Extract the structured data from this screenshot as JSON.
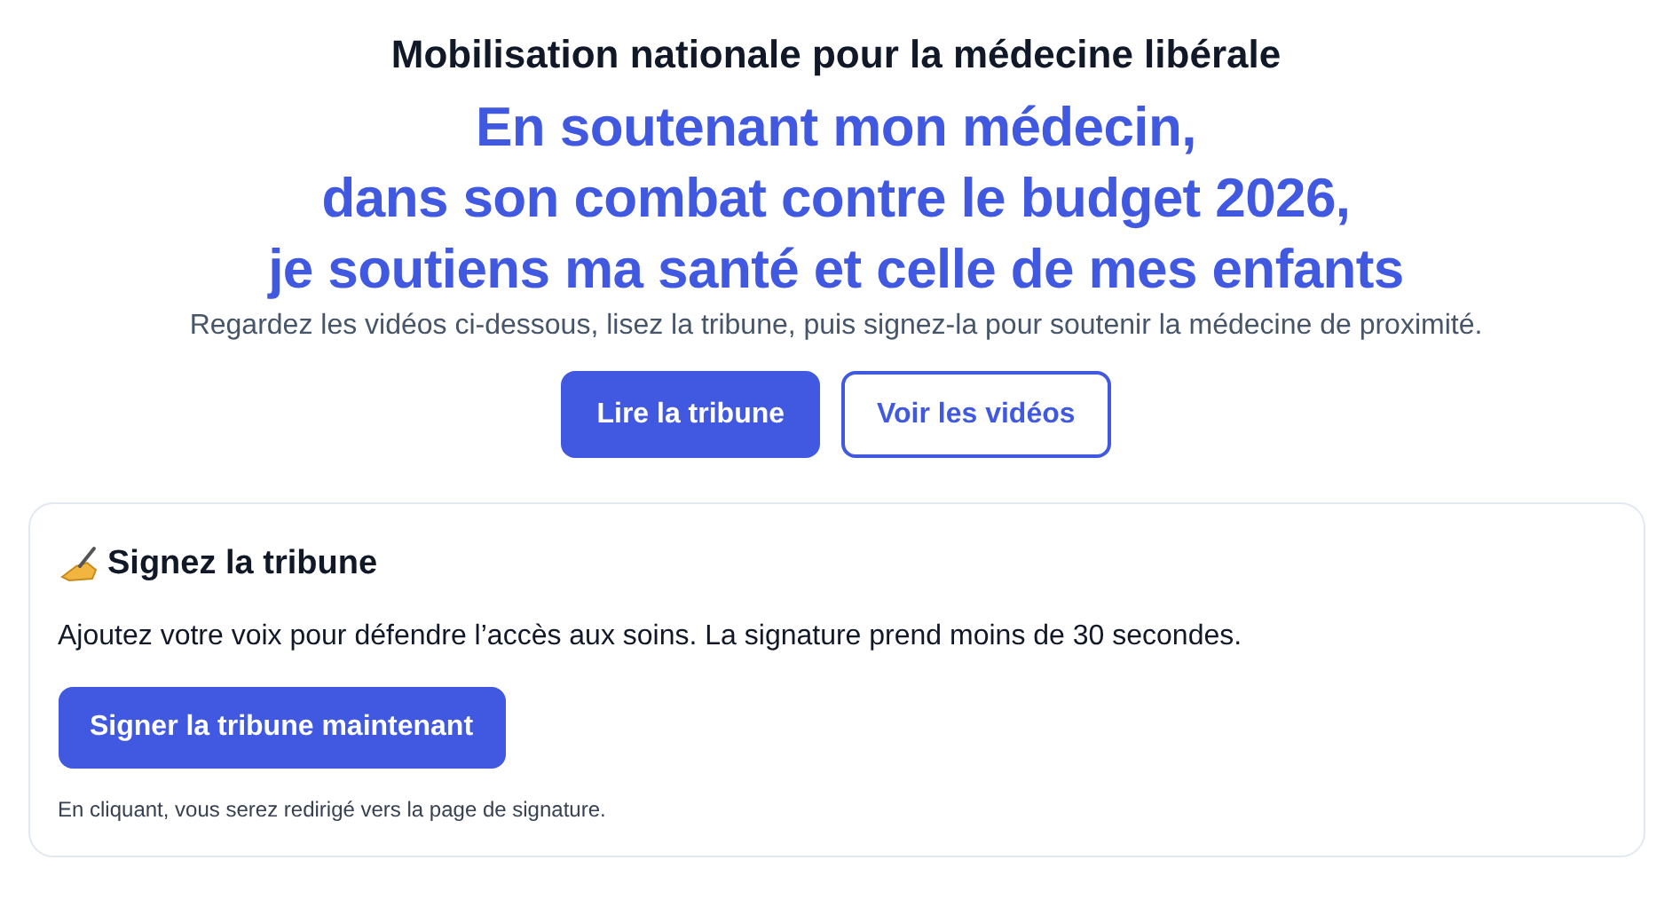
{
  "header": {
    "title": "Mobilisation nationale pour la médecine libérale",
    "headline_lines": [
      "En soutenant mon médecin,",
      "dans son combat contre le budget 2026,",
      "je soutiens ma santé et celle de mes enfants"
    ],
    "subtitle": "Regardez les vidéos ci-dessous, lisez la tribune, puis signez-la pour soutenir la médecine de proximité.",
    "buttons": [
      {
        "label": "Lire la tribune",
        "kind": "primary"
      },
      {
        "label": "Voir les vidéos",
        "kind": "outline"
      }
    ]
  },
  "sign_card": {
    "title": "Signez la tribune",
    "text": "Ajoutez votre voix pour défendre l’accès aux soins. La signature prend moins de 30 secondes.",
    "button": {
      "label": "Signer la tribune maintenant",
      "kind": "primary"
    },
    "note": "En cliquant, vous serez redirigé vers la page de signature."
  }
}
